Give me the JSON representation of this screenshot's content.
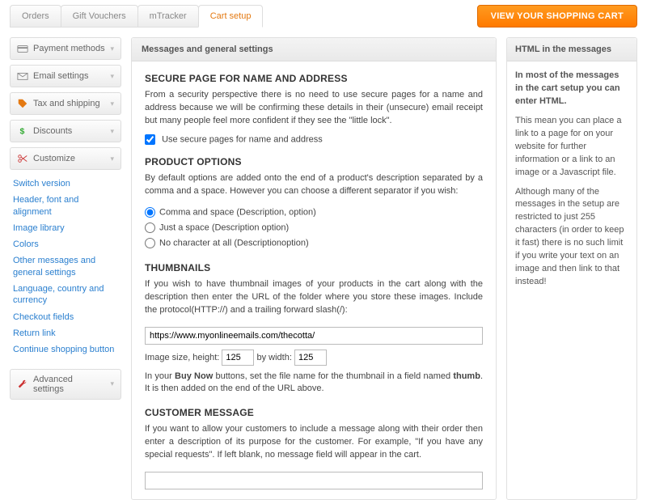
{
  "topbar": {
    "tabs": [
      "Orders",
      "Gift Vouchers",
      "mTracker",
      "Cart setup"
    ],
    "view_cart": "VIEW YOUR SHOPPING CART"
  },
  "sidebar": {
    "items": [
      {
        "label": "Payment methods"
      },
      {
        "label": "Email settings"
      },
      {
        "label": "Tax and shipping"
      },
      {
        "label": "Discounts"
      },
      {
        "label": "Customize"
      }
    ],
    "links": [
      "Switch version",
      "Header, font and alignment",
      "Image library",
      "Colors",
      "Other messages and general settings",
      "Language, country and currency",
      "Checkout fields",
      "Return link",
      "Continue shopping button"
    ],
    "advanced": "Advanced settings"
  },
  "main": {
    "header": "Messages and general settings",
    "secure": {
      "title": "SECURE PAGE FOR NAME AND ADDRESS",
      "text": "From a security perspective there is no need to use secure pages for a name and address because we will be confirming these details in their (unsecure) email receipt but many people feel more confident if they see the \"little lock\".",
      "checkbox": "Use secure pages for name and address"
    },
    "product_options": {
      "title": "PRODUCT OPTIONS",
      "text": "By default options are added onto the end of a product's description separated by a comma and a space. However you can choose a different separator if you wish:",
      "opt1": "Comma and space (Description, option)",
      "opt2": "Just a space (Description option)",
      "opt3": "No character at all (Descriptionoption)"
    },
    "thumbnails": {
      "title": "THUMBNAILS",
      "text": "If you wish to have thumbnail images of your products in the cart along with the description then enter the URL of the folder where you store these images. Include the protocol(HTTP://) and a trailing forward slash(/):",
      "url_value": "https://www.myonlineemails.com/thecotta/",
      "size_pre": "Image size, height:",
      "height": "125",
      "by_width": "by width:",
      "width": "125",
      "post_a": "In your ",
      "post_bold": "Buy Now",
      "post_b": " buttons, set the file name for the thumbnail in a field named ",
      "post_bold2": "thumb",
      "post_c": ". It is then added on the end of the URL above."
    },
    "customer_msg": {
      "title": "CUSTOMER MESSAGE",
      "text": "If you want to allow your customers to include a message along with their order then enter a description of its purpose for the customer. For example, \"If you have any special requests\". If left blank, no message field will appear in the cart.",
      "value": ""
    }
  },
  "right": {
    "header": "HTML in the messages",
    "bold": "In most of the messages in the cart setup you can enter HTML.",
    "p1": "This mean you can place a link to a page for on your website for further information or a link to an image or a Javascript file.",
    "p2": "Although many of the messages in the setup are restricted to just 255 characters (in order to keep it fast) there is no such limit if you write your text on an image and then link to that instead!"
  }
}
